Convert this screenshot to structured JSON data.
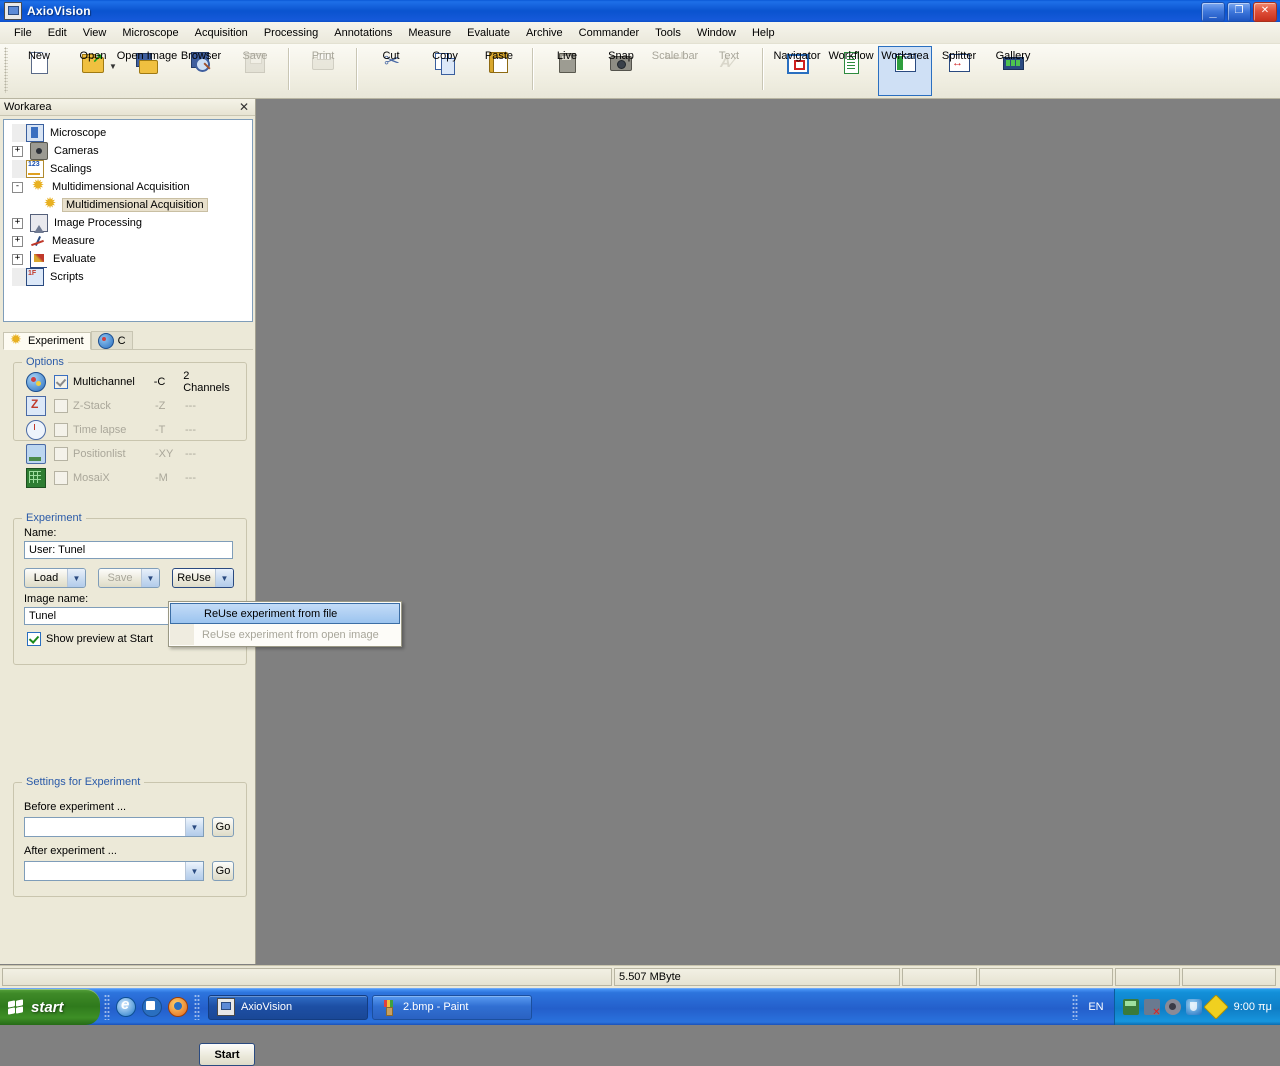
{
  "window": {
    "title": "AxioVision",
    "icon": "axiovision-icon",
    "buttons": {
      "minimize": "_",
      "restore": "❐",
      "close": "✕"
    }
  },
  "menubar": {
    "items": [
      "File",
      "Edit",
      "View",
      "Microscope",
      "Acquisition",
      "Processing",
      "Annotations",
      "Measure",
      "Evaluate",
      "Archive",
      "Commander",
      "Tools",
      "Window",
      "Help"
    ]
  },
  "toolbar": {
    "groups": [
      [
        {
          "label": "New",
          "icon": "new-document-icon",
          "state": "enabled"
        },
        {
          "label": "Open",
          "icon": "open-folder-icon",
          "state": "enabled",
          "dropdown": true
        },
        {
          "label": "Open Image",
          "icon": "open-image-icon",
          "state": "enabled"
        },
        {
          "label": "Browser",
          "icon": "browser-magnifier-icon",
          "state": "enabled"
        },
        {
          "label": "Save",
          "icon": "save-disk-icon",
          "state": "disabled"
        }
      ],
      [
        {
          "label": "Print",
          "icon": "printer-icon",
          "state": "disabled"
        }
      ],
      [
        {
          "label": "Cut",
          "icon": "scissors-icon",
          "state": "enabled"
        },
        {
          "label": "Copy",
          "icon": "copy-icon",
          "state": "enabled"
        },
        {
          "label": "Paste",
          "icon": "paste-clipboard-icon",
          "state": "enabled"
        }
      ],
      [
        {
          "label": "Live",
          "icon": "live-camera-icon",
          "state": "enabled"
        },
        {
          "label": "Snap",
          "icon": "snap-camera-icon",
          "state": "enabled"
        },
        {
          "label": "Scale bar",
          "icon": "scale-bar-icon",
          "state": "disabled"
        },
        {
          "label": "Text",
          "icon": "text-annotation-icon",
          "state": "disabled"
        }
      ],
      [
        {
          "label": "Navigator",
          "icon": "navigator-icon",
          "state": "enabled"
        },
        {
          "label": "Workflow",
          "icon": "workflow-icon",
          "state": "enabled"
        },
        {
          "label": "Workarea",
          "icon": "workarea-icon",
          "state": "selected"
        },
        {
          "label": "Splitter",
          "icon": "splitter-icon",
          "state": "enabled"
        },
        {
          "label": "Gallery",
          "icon": "gallery-icon",
          "state": "enabled"
        }
      ]
    ]
  },
  "dock": {
    "title": "Workarea",
    "close_glyph": "✕",
    "tree": [
      {
        "label": "Microscope",
        "icon": "microscope-icon",
        "expander": "none",
        "indent": 1,
        "selected": false
      },
      {
        "label": "Cameras",
        "icon": "camera-icon",
        "expander": "+",
        "indent": 1,
        "selected": false
      },
      {
        "label": "Scalings",
        "icon": "scalings-icon",
        "expander": "none",
        "indent": 1,
        "selected": false
      },
      {
        "label": "Multidimensional Acquisition",
        "icon": "multidim-acquisition-icon",
        "expander": "-",
        "indent": 1,
        "selected": false
      },
      {
        "label": "Multidimensional Acquisition",
        "icon": "multidim-acquisition-icon",
        "expander": "none",
        "indent": 2,
        "selected": true
      },
      {
        "label": "Image Processing",
        "icon": "image-processing-icon",
        "expander": "+",
        "indent": 1,
        "selected": false
      },
      {
        "label": "Measure",
        "icon": "measure-icon",
        "expander": "+",
        "indent": 1,
        "selected": false
      },
      {
        "label": "Evaluate",
        "icon": "evaluate-icon",
        "expander": "+",
        "indent": 1,
        "selected": false
      },
      {
        "label": "Scripts",
        "icon": "scripts-icon",
        "expander": "none",
        "indent": 1,
        "selected": false
      }
    ]
  },
  "tabs": [
    {
      "label": "Experiment",
      "icon": "experiment-star-icon",
      "active": true
    },
    {
      "label": "C",
      "icon": "channels-icon",
      "active": false
    }
  ],
  "options": {
    "caption": "Options",
    "rows": [
      {
        "icon": "multichannel-icon",
        "label": "Multichannel",
        "checked": true,
        "enabled": true,
        "code": "-C",
        "value": "2 Channels"
      },
      {
        "icon": "zstack-icon",
        "label": "Z-Stack",
        "checked": false,
        "enabled": false,
        "code": "-Z",
        "value": "---"
      },
      {
        "icon": "timelapse-icon",
        "label": "Time lapse",
        "checked": false,
        "enabled": false,
        "code": "-T",
        "value": "---"
      },
      {
        "icon": "positionlist-icon",
        "label": "Positionlist",
        "checked": false,
        "enabled": false,
        "code": "-XY",
        "value": "---"
      },
      {
        "icon": "mosaix-icon",
        "label": "MosaiX",
        "checked": false,
        "enabled": false,
        "code": "-M",
        "value": "---"
      }
    ]
  },
  "experiment": {
    "caption": "Experiment",
    "name_label": "Name:",
    "name_value": "User: Tunel",
    "load_label": "Load",
    "save_label": "Save",
    "reuse_label": "ReUse",
    "image_name_label": "Image name:",
    "image_name_value": "Tunel",
    "preview_label": "Show preview at Start",
    "preview_checked": true,
    "arrow_glyph": "▼"
  },
  "reuse_menu": {
    "items": [
      {
        "label": "ReUse experiment from file",
        "highlighted": true,
        "enabled": true
      },
      {
        "label": "ReUse experiment from open image",
        "highlighted": false,
        "enabled": false
      }
    ]
  },
  "settings": {
    "caption": "Settings for Experiment",
    "before_label": "Before experiment ...",
    "before_value": "",
    "after_label": "After experiment ...",
    "after_value": "",
    "go_label": "Go",
    "arrow_glyph": "▼"
  },
  "start_button": {
    "label": "Start"
  },
  "statusbar": {
    "cells": [
      "",
      "5.507 MByte",
      "",
      "",
      "",
      ""
    ]
  },
  "taskbar": {
    "start_label": "start",
    "quicklaunch": [
      {
        "name": "internet-explorer-icon"
      },
      {
        "name": "outlook-express-icon"
      },
      {
        "name": "firefox-icon"
      }
    ],
    "tasks": [
      {
        "label": "AxioVision",
        "icon": "axiovision-icon",
        "active": true
      },
      {
        "label": "2.bmp - Paint",
        "icon": "paint-icon",
        "active": false
      }
    ],
    "language": "EN",
    "tray_icons": [
      "network-icon",
      "display-disconnected-icon",
      "volume-icon",
      "security-shield-icon",
      "update-icon"
    ],
    "clock": "9:00 πμ"
  },
  "colors": {
    "titlebar_blue": "#0a53cf",
    "panel_beige": "#ece9d8",
    "mdi_gray": "#808080",
    "accent_blue": "#2a5aa8",
    "highlight": "#9cc4ef"
  }
}
